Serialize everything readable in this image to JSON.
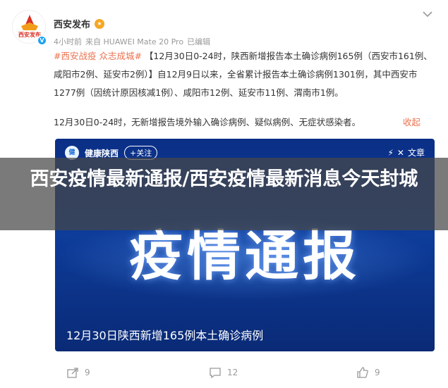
{
  "post": {
    "author": "西安发布",
    "avatar_text": "西安发布",
    "meta_time": "4小时前",
    "meta_source": "来自 HUAWEI Mate 20 Pro",
    "meta_edited": "已编辑",
    "topic": "#西安战疫 众志成城#",
    "body_main": "【12月30日0-24时，陕西新增报告本土确诊病例165例（西安市161例、咸阳市2例、延安市2例）】自12月9日以来，全省累计报告本土确诊病例1301例，其中西安市1277例（因统计原因核减1例）、咸阳市12例、延安市11例、渭南市1例。",
    "body_second": "12月30日0-24时，无新增报告境外输入确诊病例、疑似病例、无症状感染者。",
    "collapse_label": "收起"
  },
  "video": {
    "channel": "健康陕西",
    "follow_label": "+关注",
    "share_label": "文章",
    "headline": "疫情通报",
    "caption": "12月30日陕西新增165例本土确诊病例"
  },
  "overlay": {
    "title": "西安疫情最新通报/西安疫情最新消息今天封城"
  },
  "actions": {
    "share_count": "9",
    "comment_count": "12",
    "like_count": "9"
  }
}
